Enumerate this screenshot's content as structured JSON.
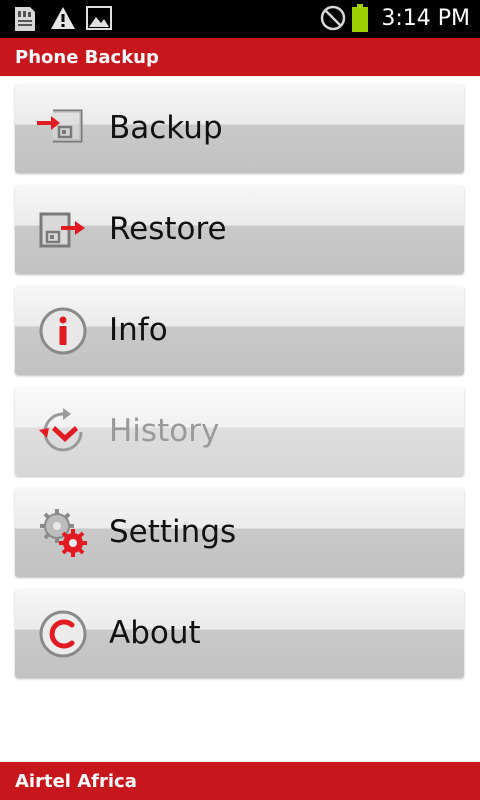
{
  "status_bar": {
    "time": "3:14 PM",
    "icons": [
      "sd-card-icon",
      "warning-icon",
      "image-icon",
      "no-signal-icon",
      "battery-icon"
    ]
  },
  "app_bar": {
    "title": "Phone Backup"
  },
  "menu": {
    "items": [
      {
        "label": "Backup",
        "icon": "backup-icon",
        "enabled": true
      },
      {
        "label": "Restore",
        "icon": "restore-icon",
        "enabled": true
      },
      {
        "label": "Info",
        "icon": "info-icon",
        "enabled": true
      },
      {
        "label": "History",
        "icon": "history-icon",
        "enabled": false
      },
      {
        "label": "Settings",
        "icon": "settings-icon",
        "enabled": true
      },
      {
        "label": "About",
        "icon": "copyright-icon",
        "enabled": true
      }
    ]
  },
  "footer": {
    "text": "Airtel Africa"
  },
  "colors": {
    "brand_red": "#c8161d",
    "status_bar": "#000000",
    "battery_green": "#9ed000"
  }
}
